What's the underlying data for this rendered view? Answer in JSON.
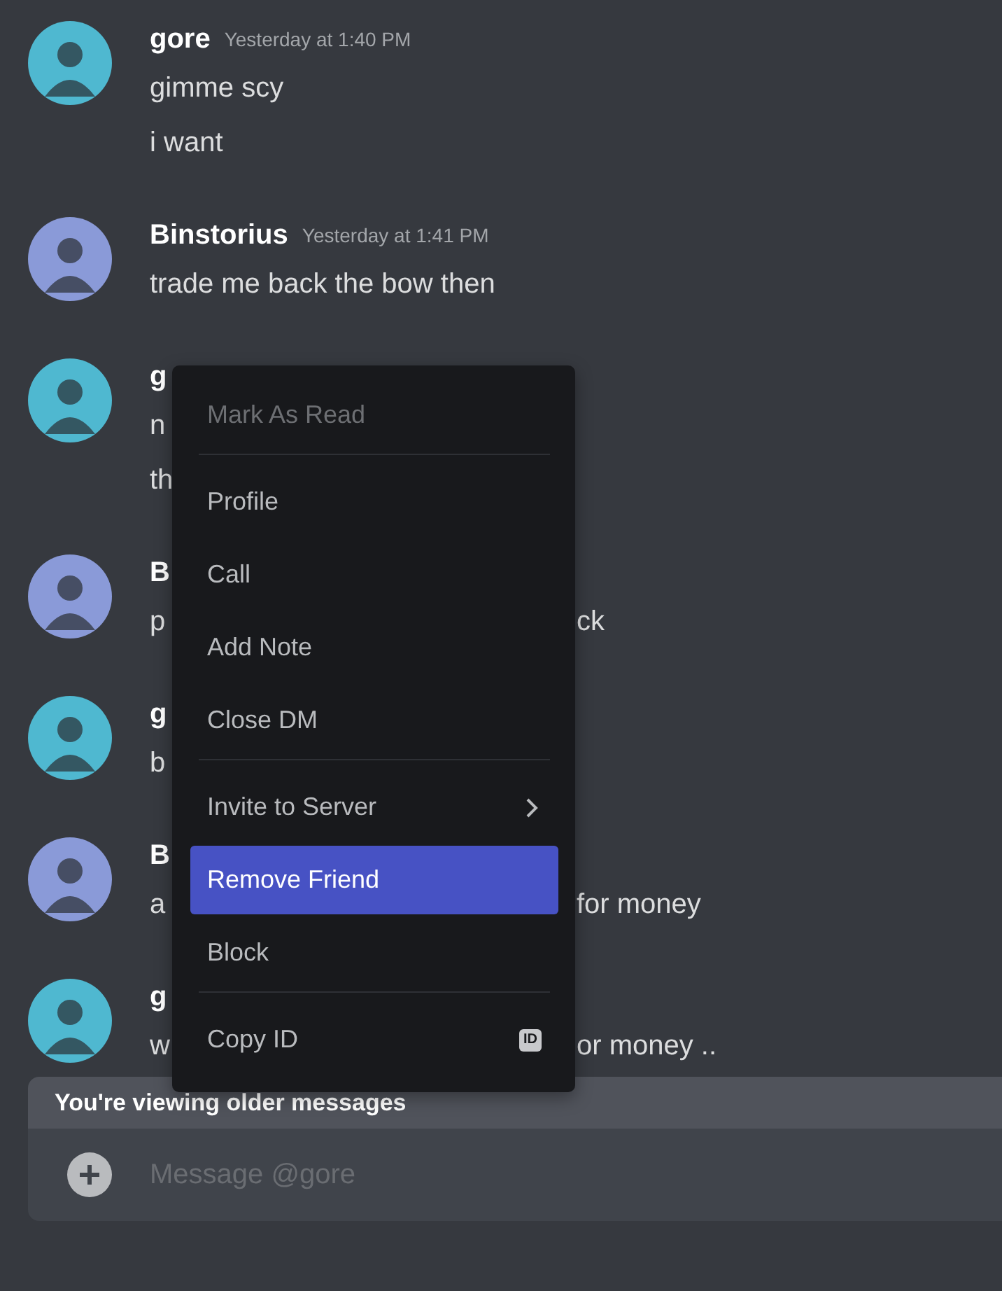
{
  "messages": [
    {
      "author": "gore",
      "timestamp": "Yesterday at 1:40 PM",
      "color": "#4fb8d0",
      "lines": [
        {
          "text": "gimme scy"
        },
        {
          "text": "i want"
        }
      ]
    },
    {
      "author": "Binstorius",
      "timestamp": "Yesterday at 1:41 PM",
      "color": "#8a9ad8",
      "lines": [
        {
          "text": "trade me back the bow then"
        }
      ]
    },
    {
      "author": "g",
      "color": "#4fb8d0",
      "lines": [
        {
          "text": "n"
        },
        {
          "text": "th"
        }
      ]
    },
    {
      "author": "B",
      "color": "#8a9ad8",
      "lines": [
        {
          "text": "p",
          "text_right": "ck"
        }
      ]
    },
    {
      "author": "g",
      "color": "#4fb8d0",
      "lines": [
        {
          "text": "b"
        }
      ]
    },
    {
      "author": "B",
      "color": "#8a9ad8",
      "lines": [
        {
          "text": "a",
          "text_right": "for money"
        }
      ]
    },
    {
      "author": "g",
      "color": "#4fb8d0",
      "lines": [
        {
          "text": "w",
          "text_right": "or money .."
        }
      ]
    }
  ],
  "context_menu": {
    "items": [
      {
        "kind": "item",
        "label": "Mark As Read",
        "disabled": true,
        "selected": false
      },
      {
        "kind": "separator"
      },
      {
        "kind": "item",
        "label": "Profile",
        "disabled": false,
        "selected": false
      },
      {
        "kind": "item",
        "label": "Call",
        "disabled": false,
        "selected": false
      },
      {
        "kind": "item",
        "label": "Add Note",
        "disabled": false,
        "selected": false
      },
      {
        "kind": "item",
        "label": "Close DM",
        "disabled": false,
        "selected": false
      },
      {
        "kind": "separator"
      },
      {
        "kind": "submenu",
        "label": "Invite to Server",
        "disabled": false,
        "selected": false
      },
      {
        "kind": "item",
        "label": "Remove Friend",
        "disabled": false,
        "selected": true
      },
      {
        "kind": "item",
        "label": "Block",
        "disabled": false,
        "selected": false
      },
      {
        "kind": "separator"
      },
      {
        "kind": "badge",
        "label": "Copy ID",
        "badge": "ID",
        "disabled": false,
        "selected": false
      }
    ]
  },
  "older_banner": "You're viewing older messages",
  "composer": {
    "placeholder": "Message @gore"
  }
}
